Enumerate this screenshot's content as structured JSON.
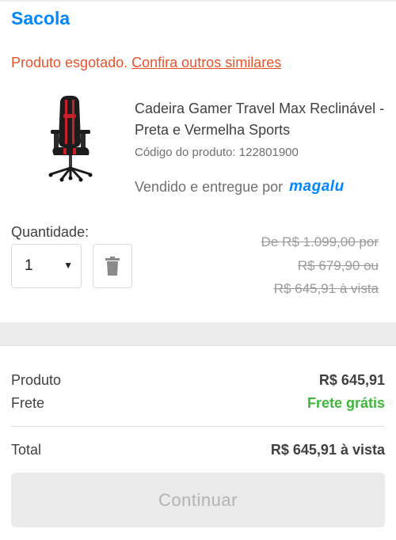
{
  "header": {
    "title": "Sacola"
  },
  "notice": {
    "text": "Produto esgotado.",
    "link_label": "Confira outros similares"
  },
  "product": {
    "image_icon": "gaming-chair-image",
    "name": "Cadeira Gamer Travel Max Reclinável - Preta e Vermelha Sports",
    "code": "Código do produto: 122801900",
    "seller_prefix": "Vendido e entregue por",
    "seller_brand": "magalu"
  },
  "quantity": {
    "label": "Quantidade:",
    "value": "1",
    "arrow_icon": "dropdown-arrow-icon",
    "delete_icon": "trash-icon"
  },
  "old_prices": {
    "line1": "De R$ 1.099,00 por",
    "line2": "R$ 679,90 ou",
    "line3": "R$ 645,91 à vista"
  },
  "summary": {
    "product_label": "Produto",
    "product_value": "R$ 645,91",
    "shipping_label": "Frete",
    "shipping_value": "Frete grátis",
    "total_label": "Total",
    "total_value": "R$ 645,91 à vista",
    "continue_label": "Continuar"
  },
  "colors": {
    "brand_blue": "#0086ff",
    "alert_orange": "#e8532c",
    "free_green": "#3eb83b"
  }
}
